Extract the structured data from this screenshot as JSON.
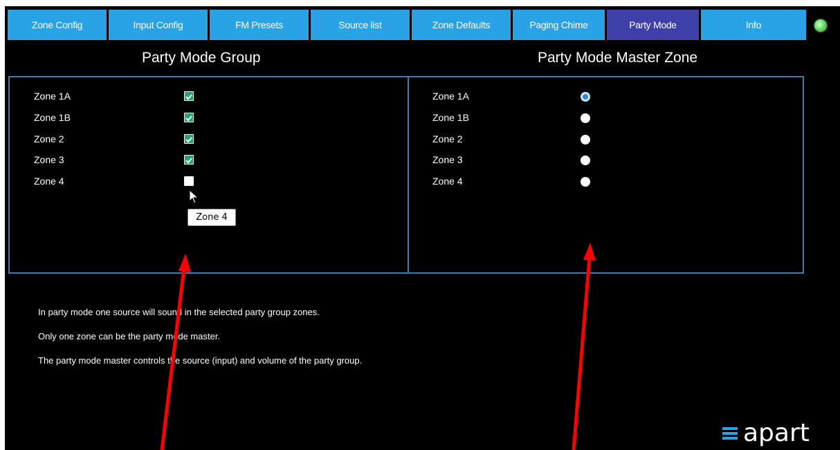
{
  "tabs": [
    {
      "label": "Zone Config"
    },
    {
      "label": "Input Config"
    },
    {
      "label": "FM Presets"
    },
    {
      "label": "Source list"
    },
    {
      "label": "Zone Defaults"
    },
    {
      "label": "Paging Chime"
    },
    {
      "label": "Party Mode"
    },
    {
      "label": "Info"
    }
  ],
  "active_tab": "Party Mode",
  "party_group": {
    "title": "Party Mode Group",
    "zones": [
      {
        "label": "Zone 1A",
        "checked": true
      },
      {
        "label": "Zone 1B",
        "checked": true
      },
      {
        "label": "Zone 2",
        "checked": true
      },
      {
        "label": "Zone 3",
        "checked": true
      },
      {
        "label": "Zone 4",
        "checked": false
      }
    ]
  },
  "master_zone": {
    "title": "Party Mode Master Zone",
    "zones": [
      {
        "label": "Zone 1A",
        "selected": true
      },
      {
        "label": "Zone 1B",
        "selected": false
      },
      {
        "label": "Zone 2",
        "selected": false
      },
      {
        "label": "Zone 3",
        "selected": false
      },
      {
        "label": "Zone 4",
        "selected": false
      }
    ]
  },
  "tooltip": "Zone 4",
  "description": [
    "In party mode one source will sound in the selected party group zones.",
    "Only one zone can be the party mode master.",
    "The party mode master controls the source (input) and volume of the party group."
  ],
  "logo_text": "apart",
  "colors": {
    "tab": "#2aa3e6",
    "tab_active": "#3f3faa",
    "panel_border": "#3f7fb0",
    "check": "#25a56a",
    "annotation_arrow": "#ff0000"
  }
}
